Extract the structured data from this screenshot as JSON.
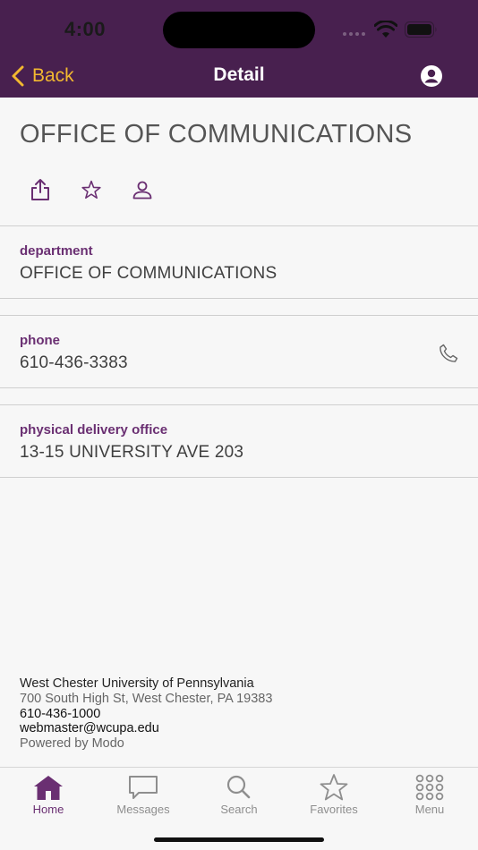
{
  "status_bar": {
    "time": "4:00"
  },
  "nav": {
    "back_label": "Back",
    "title": "Detail",
    "account_icon": "account-circle-icon"
  },
  "header": {
    "title": "OFFICE OF COMMUNICATIONS"
  },
  "actions": [
    {
      "icon": "share-icon"
    },
    {
      "icon": "star-icon"
    },
    {
      "icon": "person-icon"
    }
  ],
  "fields": [
    {
      "label": "department",
      "value": "OFFICE OF COMMUNICATIONS"
    },
    {
      "label": "phone",
      "value": "610-436-3383",
      "icon": "phone-icon"
    },
    {
      "label": "physical delivery office",
      "value": "13-15 UNIVERSITY AVE 203"
    }
  ],
  "footer": {
    "name": "West Chester University of Pennsylvania",
    "address": "700 South High St, West Chester, PA 19383",
    "phone": "610-436-1000",
    "email": "webmaster@wcupa.edu",
    "powered": "Powered by Modo"
  },
  "tabs": [
    {
      "label": "Home",
      "icon": "home-icon",
      "active": true
    },
    {
      "label": "Messages",
      "icon": "messages-icon"
    },
    {
      "label": "Search",
      "icon": "search-icon"
    },
    {
      "label": "Favorites",
      "icon": "star-icon"
    },
    {
      "label": "Menu",
      "icon": "grid-icon"
    }
  ],
  "colors": {
    "header_bg": "#48204f",
    "accent": "#6a2f72",
    "back_yellow": "#f2b830",
    "page_bg": "#f7f7f7"
  }
}
